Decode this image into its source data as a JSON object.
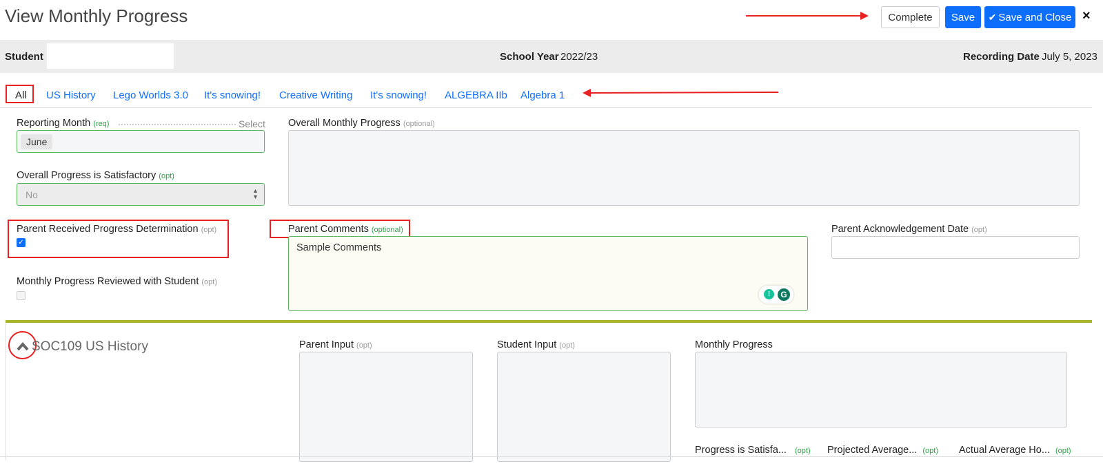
{
  "header": {
    "title": "View Monthly Progress",
    "complete_label": "Complete",
    "save_label": "Save",
    "save_close_label": "Save and Close",
    "close_icon": "×"
  },
  "info": {
    "student_label": "Student",
    "student_value": "",
    "school_year_label": "School Year",
    "school_year_value": "2022/23",
    "recording_date_label": "Recording Date",
    "recording_date_value": "July 5, 2023"
  },
  "tabs": [
    {
      "label": "All"
    },
    {
      "label": "US History"
    },
    {
      "label": "Lego Worlds 3.0"
    },
    {
      "label": "It's snowing!"
    },
    {
      "label": "Creative Writing"
    },
    {
      "label": "It's snowing!"
    },
    {
      "label": "ALGEBRA IIb"
    },
    {
      "label": "Algebra 1"
    }
  ],
  "form": {
    "reporting_month_label": "Reporting Month",
    "reporting_month_tag": "(req)",
    "reporting_month_select": "Select",
    "reporting_month_value": "June",
    "overall_monthly_progress_label": "Overall Monthly Progress",
    "overall_monthly_progress_tag": "(optional)",
    "overall_satisfactory_label": "Overall Progress is Satisfactory",
    "overall_satisfactory_tag": "(opt)",
    "overall_satisfactory_value": "No",
    "parent_received_label": "Parent Received Progress Determination",
    "parent_received_tag": "(opt)",
    "parent_received_checked": true,
    "parent_comments_label": "Parent Comments",
    "parent_comments_tag": "(optional)",
    "parent_comments_value": "Sample Comments",
    "parent_ack_label": "Parent Acknowledgement Date",
    "parent_ack_tag": "(opt)",
    "reviewed_label": "Monthly Progress Reviewed with Student",
    "reviewed_tag": "(opt)",
    "reviewed_checked": false
  },
  "course": {
    "title": "SOC109 US History",
    "parent_input_label": "Parent Input",
    "parent_input_tag": "(opt)",
    "student_input_label": "Student Input",
    "student_input_tag": "(opt)",
    "monthly_progress_label": "Monthly Progress",
    "progress_satisfactory_label": "Progress is Satisfa...",
    "progress_satisfactory_tag": "(opt)",
    "projected_average_label": "Projected Average...",
    "projected_average_tag": "(opt)",
    "actual_average_label": "Actual Average Ho...",
    "actual_average_tag": "(opt)"
  },
  "colors": {
    "primary": "#0d6efd",
    "required_green": "#28a745",
    "annotation_red": "#e8201f",
    "section_olive": "#a8b52a"
  },
  "icons": [
    "close-icon",
    "chevron-up-icon",
    "checkmark-icon",
    "select-arrows-icon",
    "grammarly-icon",
    "lightbulb-icon"
  ]
}
